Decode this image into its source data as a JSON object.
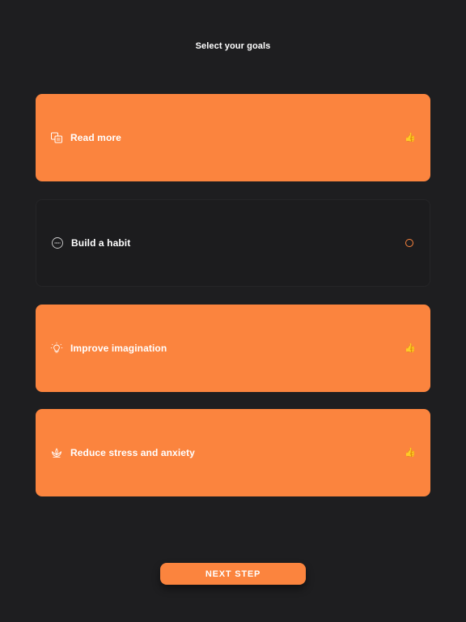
{
  "header": {
    "title": "Select your goals"
  },
  "goals": [
    {
      "label": "Read more",
      "selected": true,
      "icon": "books-icon"
    },
    {
      "label": "Build a habit",
      "selected": false,
      "icon": "habit-badge-icon"
    },
    {
      "label": "Improve imagination",
      "selected": true,
      "icon": "lightbulb-icon"
    },
    {
      "label": "Reduce stress and anxiety",
      "selected": true,
      "icon": "lotus-icon"
    }
  ],
  "status_icons": {
    "selected": "thumbs-up-icon",
    "unselected": "radio-empty-icon"
  },
  "footer": {
    "next_label": "NEXT STEP"
  },
  "colors": {
    "background": "#1e1e20",
    "accent": "#fb843e",
    "thumb": "#f6d21f",
    "text": "#ffffff"
  }
}
